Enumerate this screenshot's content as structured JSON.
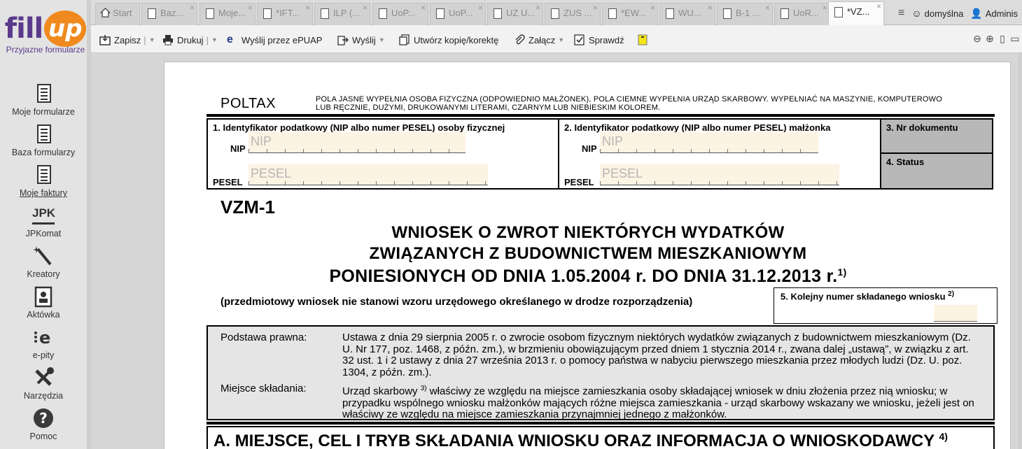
{
  "app": {
    "logo_word": "fill",
    "logo_badge": "up",
    "tagline": "Przyjazne formularze"
  },
  "sidebar": {
    "items": [
      {
        "label": "Moje formularze",
        "icon": "document-list-icon"
      },
      {
        "label": "Baza formularzy",
        "icon": "forms-database-icon"
      },
      {
        "label": "Moje faktury",
        "icon": "invoices-icon"
      },
      {
        "label": "JPKomat",
        "icon": "jpk-icon",
        "icon_text": "JPK"
      },
      {
        "label": "Kreatory",
        "icon": "magic-wand-icon"
      },
      {
        "label": "Aktówka",
        "icon": "briefcase-icon"
      },
      {
        "label": "e-pity",
        "icon": "epity-icon"
      },
      {
        "label": "Narzędzia",
        "icon": "tools-icon"
      },
      {
        "label": "Pomoc",
        "icon": "help-icon"
      }
    ]
  },
  "tabs": {
    "start": "Start",
    "items": [
      "Baz...",
      "Moje...",
      "*IFT...",
      "ILP (...",
      "UoP...",
      "UoP...",
      "UZ U...",
      "ZUS ...",
      "*EW...",
      "WU...",
      "B-1 ...",
      "UoR...",
      "*VZ..."
    ],
    "profile": "domyślna",
    "user": "Adminis"
  },
  "toolbar": {
    "save": "Zapisz",
    "print": "Drukuj",
    "epuap": "Wyślij przez ePUAP",
    "send": "Wyślij",
    "copy": "Utwórz kopię/korektę",
    "attach": "Załącz",
    "check": "Sprawdź"
  },
  "form": {
    "poltax": "POLTAX",
    "instructions": "POLA JASNE WYPEŁNIA OSOBA FIZYCZNA (ODPOWIEDNIO MAŁŻONEK), POLA CIEMNE WYPEŁNIA URZĄD SKARBOWY. WYPEŁNIAĆ NA MASZYNIE, KOMPUTEROWO LUB RĘCZNIE, DUŻYMI, DRUKOWANYMI LITERAMI, CZARNYM LUB NIEBIESKIM KOLOREM.",
    "field1_title": "1. Identyfikator podatkowy (NIP albo numer PESEL) osoby fizycznej",
    "field2_title": "2. Identyfikator podatkowy (NIP albo numer PESEL) małżonka",
    "field3_title": "3. Nr dokumentu",
    "field4_title": "4. Status",
    "nip_label": "NIP",
    "pesel_label": "PESEL",
    "nip_placeholder": "NIP",
    "pesel_placeholder": "PESEL",
    "code": "VZM-1",
    "title1": "WNIOSEK O ZWROT NIEKTÓRYCH WYDATKÓW",
    "title2": "ZWIĄZANYCH Z BUDOWNICTWEM MIESZKANIOWYM",
    "title3": "PONIESIONYCH OD DNIA 1.05.2004 r. DO DNIA 31.12.2013 r.",
    "title3_note": "1)",
    "note": "(przedmiotowy wniosek nie stanowi wzoru urzędowego określanego w drodze rozporządzenia)",
    "field5_title": "5. Kolejny numer składanego wniosku",
    "field5_note": "2)",
    "legal_basis_label": "Podstawa prawna:",
    "legal_basis_text": "Ustawa z dnia 29 sierpnia 2005 r. o zwrocie osobom fizycznym niektórych wydatków związanych z budownictwem mieszkaniowym (Dz. U. Nr 177, poz. 1468, z późn. zm.), w brzmieniu obowiązującym przed dniem 1 stycznia 2014 r., zwana dalej „ustawą”, w związku z art. 32 ust. 1 i 2 ustawy z dnia 27 września 2013 r. o pomocy państwa w nabyciu pierwszego mieszkania przez młodych ludzi (Dz. U. poz. 1304, z późn. zm.).",
    "place_label": "Miejsce składania:",
    "place_text_a": "Urząd skarbowy",
    "place_note": "3)",
    "place_text_b": "właściwy ze względu na miejsce zamieszkania osoby składającej wniosek w dniu złożenia przez nią wniosku; w przypadku wspólnego wniosku małżonków mających różne miejsca zamieszkania - urząd skarbowy wskazany we wniosku, jeżeli jest on właściwy ze względu na miejsce zamieszkania przynajmniej jednego z małżonków.",
    "section_a": "A. MIEJSCE, CEL I TRYB SKŁADANIA WNIOSKU ORAZ INFORMACJA O WNIOSKODAWCY",
    "section_a_note": "4)"
  }
}
